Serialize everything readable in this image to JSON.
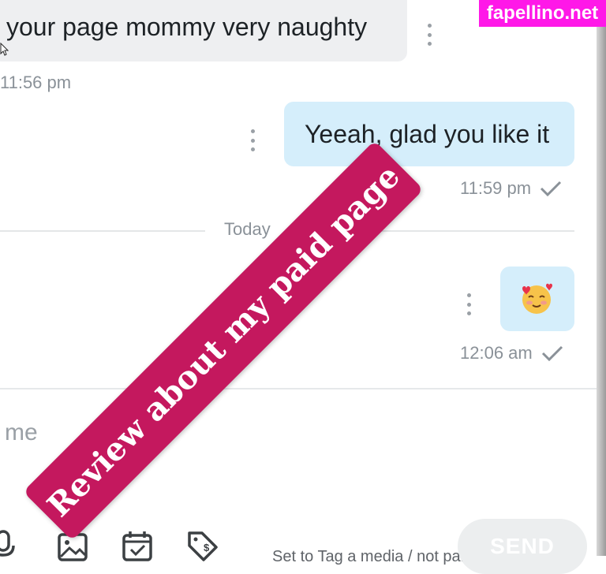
{
  "watermark": {
    "text": "fapellino.net"
  },
  "conversation": {
    "messages": [
      {
        "direction": "incoming",
        "text": "your page mommy very naughty",
        "time": "11:56 pm"
      },
      {
        "direction": "outgoing",
        "text": "Yeeah, glad you like it",
        "time": "11:59 pm",
        "status_icon": "check-icon"
      },
      {
        "direction": "outgoing",
        "text": "🥰",
        "time": "12:06 am",
        "status_icon": "check-icon"
      }
    ],
    "date_divider": "Today"
  },
  "composer": {
    "placeholder_visible": "me",
    "tools": [
      "microphone-icon",
      "image-icon",
      "calendar-icon",
      "price-tag-icon"
    ],
    "send_label": "SEND",
    "footer_text": "Set to Tag a media / not paid"
  },
  "overlay_banner": {
    "text": "Review about my paid page",
    "color": "#c4185e"
  },
  "colors": {
    "incoming_bubble": "#eeeff1",
    "outgoing_bubble": "#d5eefb",
    "watermark_bg": "#ff18e8"
  }
}
